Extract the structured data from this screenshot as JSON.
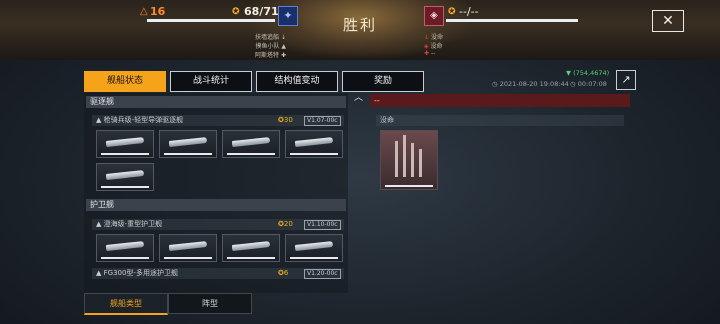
{
  "header": {
    "title": "胜利",
    "player_level": "16",
    "player_hp": "68/71",
    "enemy_hp": "--/--",
    "player_stats": [
      "扶墙追船",
      "摸鱼小队",
      "阿斯塔特"
    ],
    "enemy_stats": [
      "没命",
      "没命",
      "--"
    ],
    "close_label": "✕"
  },
  "tabs": [
    {
      "label": "舰船状态",
      "active": true
    },
    {
      "label": "战斗统计",
      "active": false
    },
    {
      "label": "结构值变动",
      "active": false
    },
    {
      "label": "奖励",
      "active": false
    }
  ],
  "meta": {
    "coords": "(754,4674)",
    "datetime": "2021-08-20 19:08:44",
    "duration": "00:07:08"
  },
  "fleet": {
    "sections": [
      {
        "label": "驱逐舰",
        "classes": [
          {
            "name": "枪骑兵级-轻型导弹驱逐舰",
            "cost": "30",
            "version": "V1.07-00c",
            "ships": 5
          }
        ]
      },
      {
        "label": "护卫舰",
        "classes": [
          {
            "name": "澄海级-重型护卫舰",
            "cost": "20",
            "version": "V1.10-00c",
            "ships": 4
          },
          {
            "name": "FG300型-多用途护卫舰",
            "cost": "6",
            "version": "V1.20-00c",
            "ships": 0
          }
        ]
      }
    ]
  },
  "enemy": {
    "header": "--",
    "sunk_label": "没命"
  },
  "bottom_tabs": [
    {
      "label": "舰船类型",
      "active": true
    },
    {
      "label": "阵型",
      "active": false
    }
  ],
  "colors": {
    "accent": "#f5a31b",
    "enemy_red": "#5a1a1c",
    "green": "#54d276"
  }
}
